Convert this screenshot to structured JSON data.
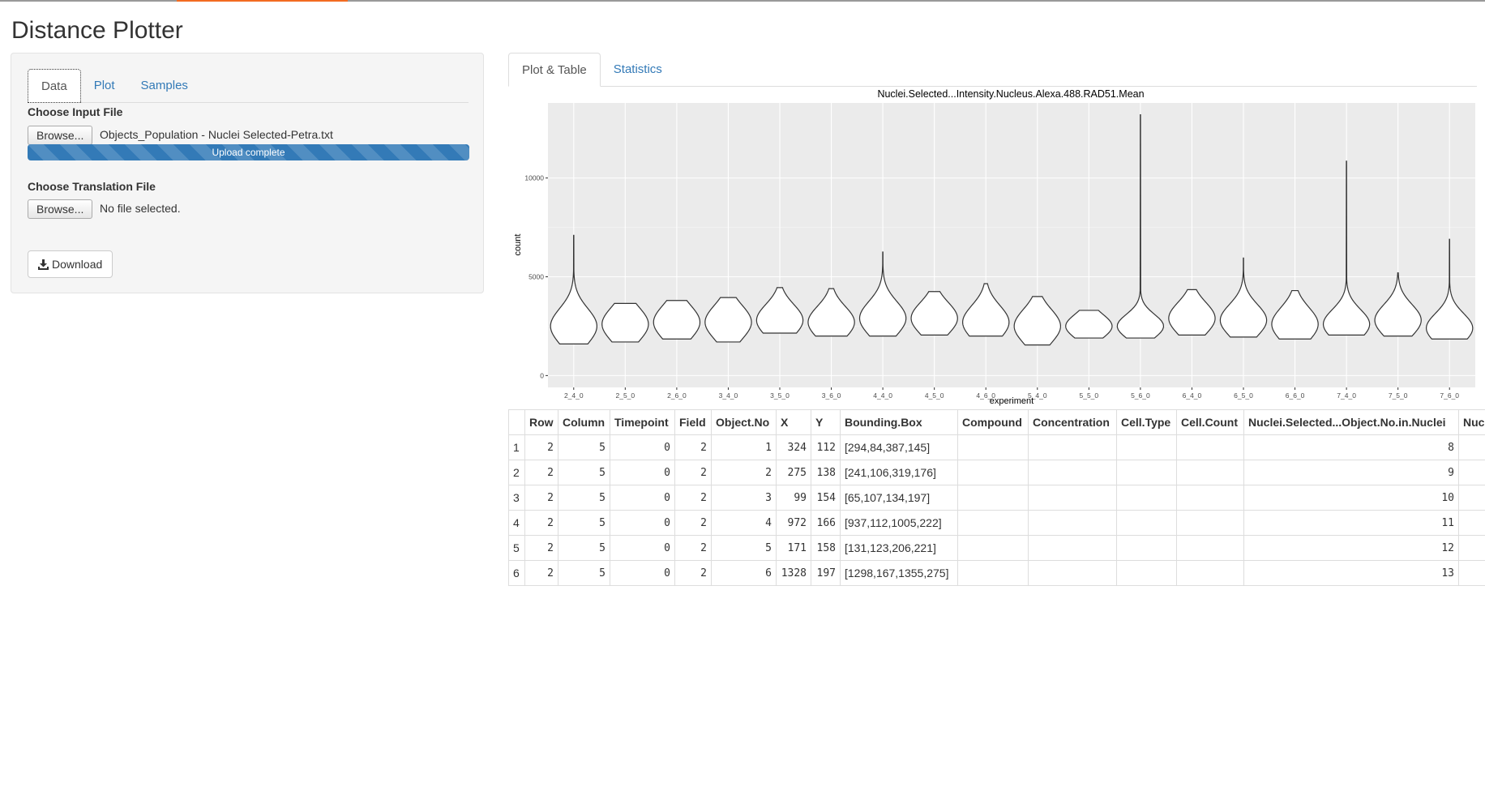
{
  "app": {
    "title": "Distance Plotter"
  },
  "left_tabs": [
    {
      "label": "Data"
    },
    {
      "label": "Plot"
    },
    {
      "label": "Samples"
    }
  ],
  "input": {
    "label": "Choose Input File",
    "browse_label": "Browse...",
    "filename": "Objects_Population - Nuclei Selected-Petra.txt",
    "progress_text": "Upload complete",
    "progress": 1.0
  },
  "translation": {
    "label": "Choose Translation File",
    "browse_label": "Browse...",
    "filename": "No file selected."
  },
  "download": {
    "label": "Download",
    "icon": "download-icon"
  },
  "right_tabs": [
    {
      "label": "Plot & Table"
    },
    {
      "label": "Statistics"
    }
  ],
  "chart_data": {
    "type": "violin",
    "title": "Nuclei.Selected...Intensity.Nucleus.Alexa.488.RAD51.Mean",
    "xlabel": "experiment",
    "ylabel": "count",
    "ylim": [
      -600,
      13800
    ],
    "yticks": [
      0,
      5000,
      10000
    ],
    "grid": true,
    "background": "#ebebeb",
    "categories": [
      "2_4_0",
      "2_5_0",
      "2_6_0",
      "3_4_0",
      "3_5_0",
      "3_6_0",
      "4_4_0",
      "4_5_0",
      "4_6_0",
      "5_4_0",
      "5_5_0",
      "5_6_0",
      "6_4_0",
      "6_5_0",
      "6_6_0",
      "7_4_0",
      "7_5_0",
      "7_6_0"
    ],
    "violins": [
      {
        "min": 1600,
        "max": 7100,
        "mode": 2500,
        "spread": 900
      },
      {
        "min": 1700,
        "max": 3650,
        "mode": 2600,
        "spread": 850
      },
      {
        "min": 1850,
        "max": 3800,
        "mode": 2700,
        "spread": 850
      },
      {
        "min": 1700,
        "max": 3950,
        "mode": 2700,
        "spread": 850
      },
      {
        "min": 2150,
        "max": 4450,
        "mode": 2800,
        "spread": 800
      },
      {
        "min": 2000,
        "max": 4400,
        "mode": 2700,
        "spread": 800
      },
      {
        "min": 2000,
        "max": 6250,
        "mode": 2900,
        "spread": 850
      },
      {
        "min": 2050,
        "max": 4250,
        "mode": 2900,
        "spread": 800
      },
      {
        "min": 2000,
        "max": 4650,
        "mode": 2700,
        "spread": 850
      },
      {
        "min": 1550,
        "max": 4000,
        "mode": 2500,
        "spread": 850
      },
      {
        "min": 1900,
        "max": 3300,
        "mode": 2500,
        "spread": 600
      },
      {
        "min": 1900,
        "max": 13200,
        "mode": 2500,
        "spread": 600
      },
      {
        "min": 2050,
        "max": 4350,
        "mode": 2900,
        "spread": 800
      },
      {
        "min": 1950,
        "max": 5950,
        "mode": 2800,
        "spread": 800
      },
      {
        "min": 1850,
        "max": 4300,
        "mode": 2600,
        "spread": 850
      },
      {
        "min": 2050,
        "max": 10850,
        "mode": 2600,
        "spread": 750
      },
      {
        "min": 2000,
        "max": 5200,
        "mode": 2800,
        "spread": 800
      },
      {
        "min": 1850,
        "max": 6900,
        "mode": 2400,
        "spread": 750
      }
    ]
  },
  "table": {
    "columns": [
      "",
      "Row",
      "Column",
      "Timepoint",
      "Field",
      "Object.No",
      "X",
      "Y",
      "Bounding.Box",
      "Compound",
      "Concentration",
      "Cell.Type",
      "Cell.Count",
      "Nuclei.Selected...Object.No.in.Nuclei",
      "Nucle"
    ],
    "rows": [
      [
        "1",
        "2",
        "5",
        "0",
        "2",
        "1",
        "324",
        "112",
        "[294,84,387,145]",
        "",
        "",
        "",
        "",
        "8",
        ""
      ],
      [
        "2",
        "2",
        "5",
        "0",
        "2",
        "2",
        "275",
        "138",
        "[241,106,319,176]",
        "",
        "",
        "",
        "",
        "9",
        ""
      ],
      [
        "3",
        "2",
        "5",
        "0",
        "2",
        "3",
        "99",
        "154",
        "[65,107,134,197]",
        "",
        "",
        "",
        "",
        "10",
        ""
      ],
      [
        "4",
        "2",
        "5",
        "0",
        "2",
        "4",
        "972",
        "166",
        "[937,112,1005,222]",
        "",
        "",
        "",
        "",
        "11",
        ""
      ],
      [
        "5",
        "2",
        "5",
        "0",
        "2",
        "5",
        "171",
        "158",
        "[131,123,206,221]",
        "",
        "",
        "",
        "",
        "12",
        ""
      ],
      [
        "6",
        "2",
        "5",
        "0",
        "2",
        "6",
        "1328",
        "197",
        "[1298,167,1355,275]",
        "",
        "",
        "",
        "",
        "13",
        ""
      ]
    ]
  }
}
